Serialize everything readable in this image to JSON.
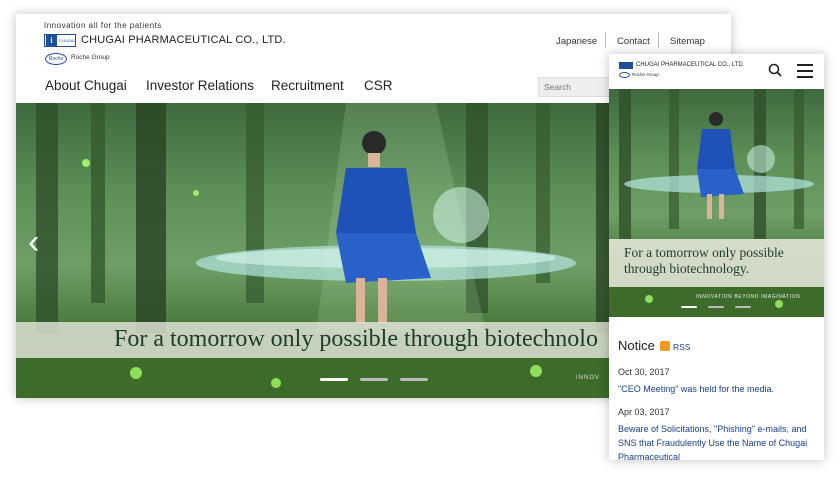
{
  "desktop": {
    "tagline": "Innovation all for the patients",
    "logo_small_text": "CHUGAI",
    "company_name": "CHUGAI PHARMACEUTICAL CO., LTD.",
    "roche_badge": "Roche",
    "roche_group": "Roche Group",
    "utility_links": [
      "Japanese",
      "Contact",
      "Sitemap"
    ],
    "nav": [
      "About Chugai",
      "Investor Relations",
      "Recruitment",
      "CSR"
    ],
    "search_placeholder": "Search",
    "hero": {
      "banner_text": "For a tomorrow only possible through biotechnolo",
      "corner_text": "INNOV",
      "arrow": "‹"
    },
    "colors": {
      "brand_blue": "#1e4d9b",
      "forest_green": "#4a7a3c"
    }
  },
  "mobile": {
    "company_name": "CHUGAI PHARMACEUTICAL CO., LTD.",
    "roche_group": "Roche Group",
    "hero": {
      "banner_text": "For a tomorrow only possible through biotechnology.",
      "tagline": "INNOVATION BEYOND IMAGINATION"
    },
    "notice": {
      "title": "Notice",
      "rss": "RSS",
      "items": [
        {
          "date": "Oct 30, 2017",
          "text": "\"CEO Meeting\" was held for the media."
        },
        {
          "date": "Apr 03, 2017",
          "text": "Beware of Solicitations, \"Phishing\" e-mails, and SNS that Fraudulently Use the Name of Chugai Pharmaceutical"
        }
      ]
    }
  }
}
